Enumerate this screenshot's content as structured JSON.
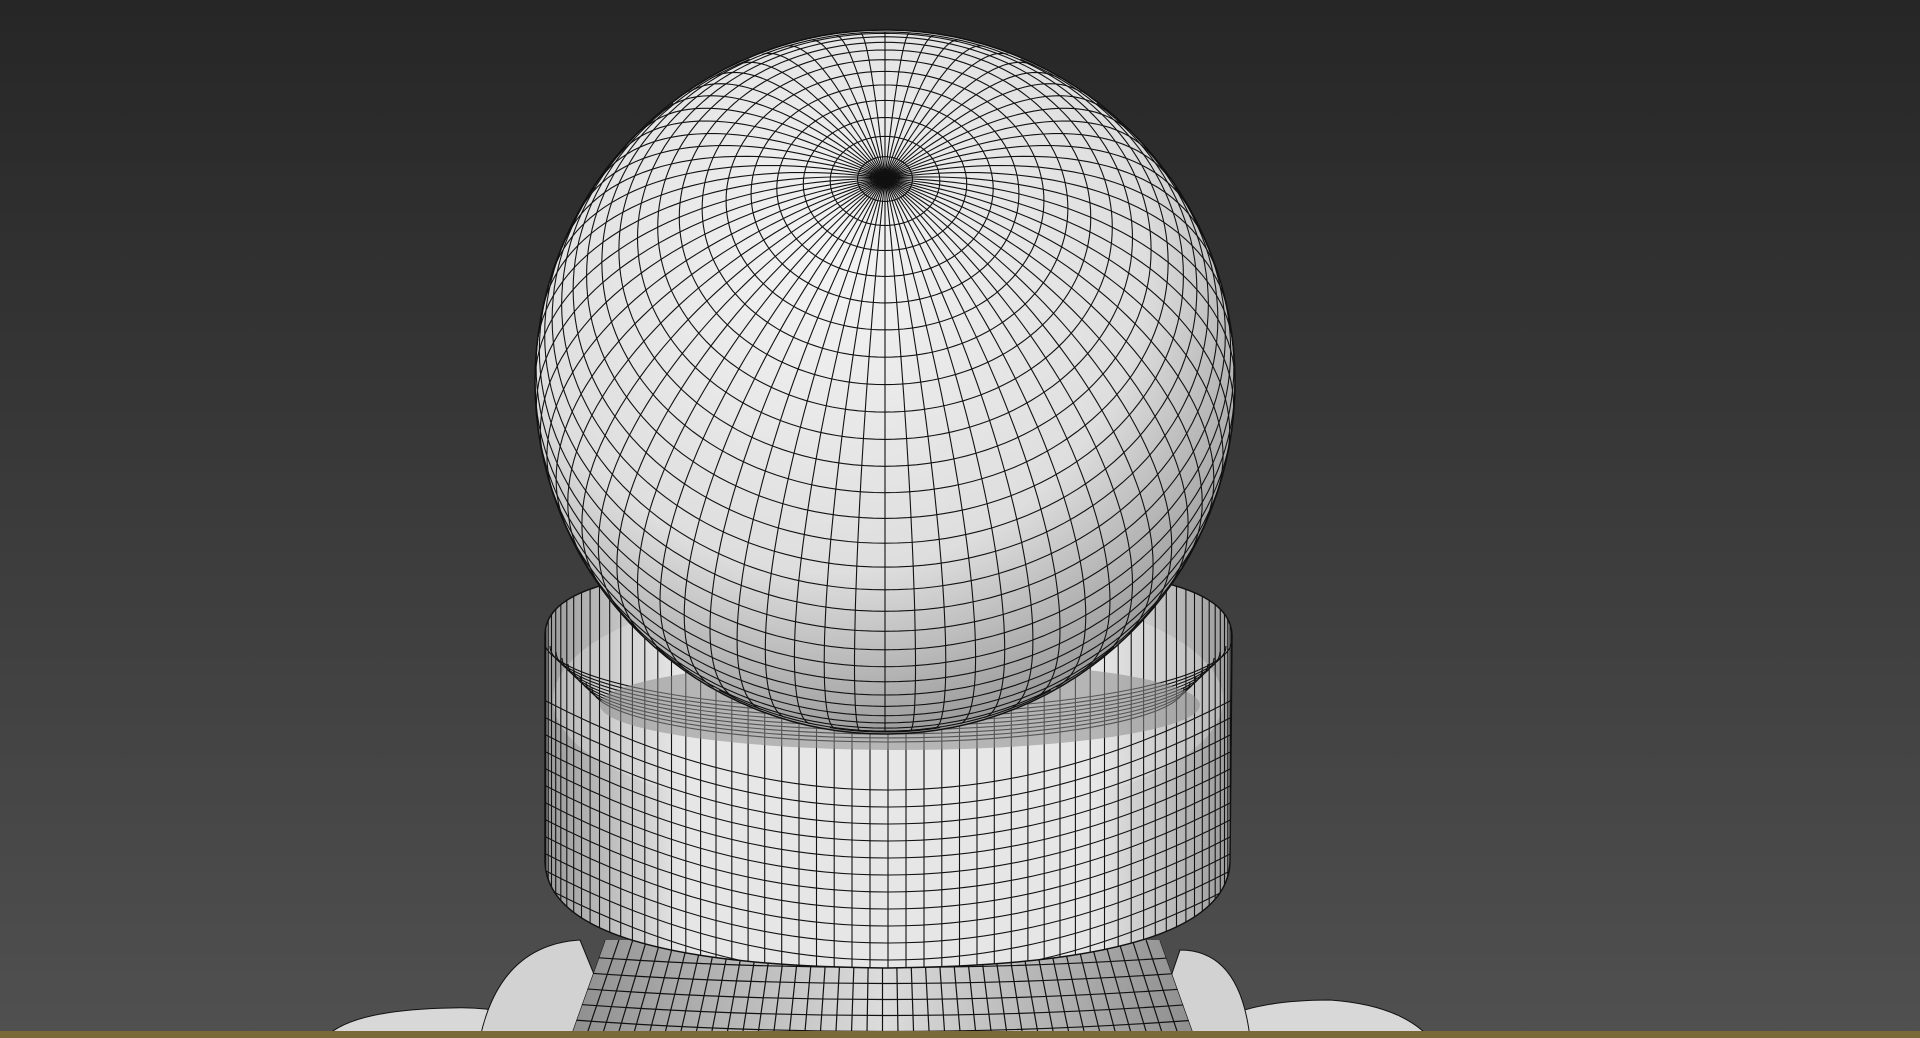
{
  "viewport": {
    "background_top": "#262626",
    "background_bottom": "#505050",
    "mesh_color": "#eeeeee",
    "mesh_shadow": "#6a6a6a",
    "wire_color": "#111111",
    "highlight_border": "#7a6a3a",
    "view_label": ""
  }
}
